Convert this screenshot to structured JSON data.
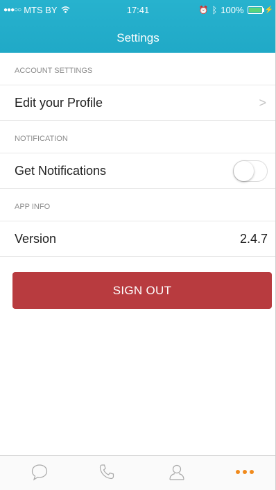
{
  "status_bar": {
    "carrier": "MTS BY",
    "time": "17:41",
    "battery": "100%"
  },
  "header": {
    "title": "Settings"
  },
  "sections": {
    "account": "ACCOUNT SETTINGS",
    "notification": "NOTIFICATION",
    "app_info": "APP INFO"
  },
  "rows": {
    "edit_profile": "Edit your Profile",
    "get_notifications": "Get Notifications",
    "version_label": "Version",
    "version_value": "2.4.7"
  },
  "notifications_enabled": false,
  "sign_out_label": "SIGN OUT",
  "tabs": [
    "chat-icon",
    "phone-icon",
    "contacts-icon",
    "more-icon"
  ],
  "colors": {
    "header": "#22acc9",
    "sign_out": "#b83b3f",
    "active_tab": "#f08a1c"
  }
}
